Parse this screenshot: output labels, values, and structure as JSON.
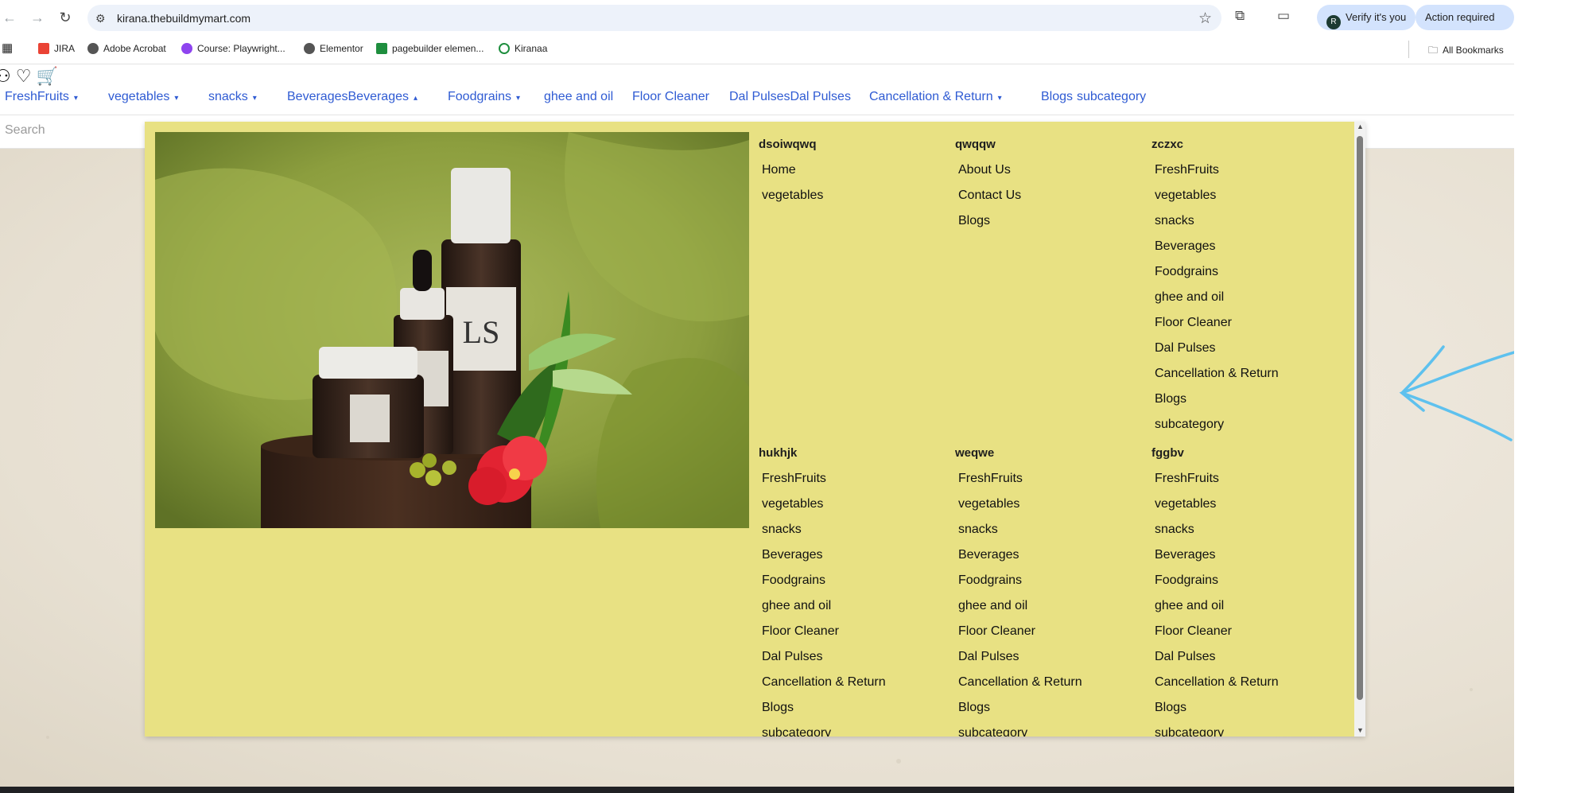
{
  "browser": {
    "url": "kirana.thebuildmymart.com",
    "verify_label": "Verify it's you",
    "action_label": "Action required",
    "bookmarks": [
      {
        "label": "JIRA",
        "color": "#ea4335"
      },
      {
        "label": "Adobe Acrobat",
        "color": "#555555"
      },
      {
        "label": "Course: Playwright...",
        "color": "#8e44ef"
      },
      {
        "label": "Elementor",
        "color": "#555555"
      },
      {
        "label": "pagebuilder elemen...",
        "color": "#1e8e3e"
      },
      {
        "label": "Kiranaa",
        "color": "#1e8e3e"
      }
    ],
    "all_bookmarks": "All Bookmarks"
  },
  "site": {
    "menu": [
      {
        "label": "FreshFruits",
        "caret": "▾"
      },
      {
        "label": "vegetables",
        "caret": "▾"
      },
      {
        "label": "snacks",
        "caret": "▾"
      },
      {
        "label": "BeveragesBeverages",
        "caret": "▴"
      },
      {
        "label": "Foodgrains",
        "caret": "▾"
      },
      {
        "label": "ghee and oil",
        "caret": ""
      },
      {
        "label": "Floor Cleaner",
        "caret": ""
      },
      {
        "label": "Dal PulsesDal Pulses",
        "caret": ""
      },
      {
        "label": "Cancellation & Return",
        "caret": "▾"
      },
      {
        "label": "Blogs",
        "caret": ""
      },
      {
        "label": "subcategory",
        "caret": ""
      }
    ],
    "search_placeholder": "Search",
    "accent_color": "#2f5bd3",
    "mega_bg": "#e8e183"
  },
  "mega": {
    "col_dsoiwqwq": {
      "title": "dsoiwqwq",
      "items": [
        "Home",
        "vegetables"
      ]
    },
    "col_qwqqw": {
      "title": "qwqqw",
      "items": [
        "About Us",
        "Contact Us",
        "Blogs"
      ]
    },
    "col_zczxc": {
      "title": "zczxc",
      "items": [
        "FreshFruits",
        "vegetables",
        "snacks",
        "Beverages",
        "Foodgrains",
        "ghee and oil",
        "Floor Cleaner",
        "Dal Pulses",
        "Cancellation & Return",
        "Blogs",
        "subcategory"
      ]
    },
    "col_hukhjk": {
      "title": "hukhjk",
      "items": [
        "FreshFruits",
        "vegetables",
        "snacks",
        "Beverages",
        "Foodgrains",
        "ghee and oil",
        "Floor Cleaner",
        "Dal Pulses",
        "Cancellation & Return",
        "Blogs",
        "subcategory"
      ]
    },
    "col_weqwe": {
      "title": "weqwe",
      "items": [
        "FreshFruits",
        "vegetables",
        "snacks",
        "Beverages",
        "Foodgrains",
        "ghee and oil",
        "Floor Cleaner",
        "Dal Pulses",
        "Cancellation & Return",
        "Blogs",
        "subcategory"
      ]
    },
    "col_fggbv": {
      "title": "fggbv",
      "items": [
        "FreshFruits",
        "vegetables",
        "snacks",
        "Beverages",
        "Foodgrains",
        "ghee and oil",
        "Floor Cleaner",
        "Dal Pulses",
        "Cancellation & Return",
        "Blogs",
        "subcategory"
      ]
    }
  },
  "product_logo": "LS"
}
